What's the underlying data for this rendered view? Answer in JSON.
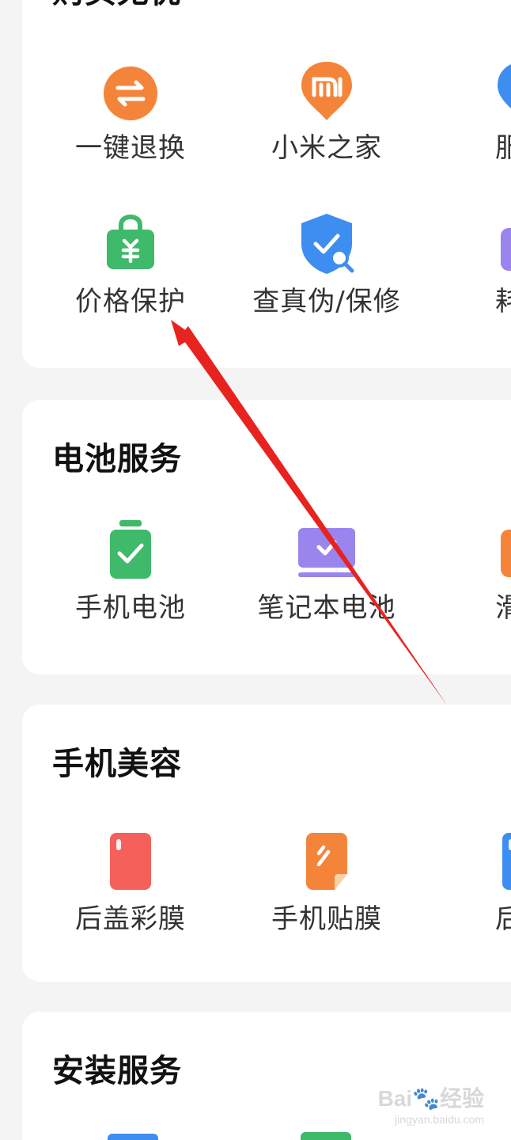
{
  "colors": {
    "orange": "#f5843b",
    "green": "#3fb96a",
    "blue": "#3d8ef0",
    "purple": "#9a84ee",
    "red": "#f5605a",
    "arrow": "#e8231f"
  },
  "sections": [
    {
      "title": "购买无忧",
      "items": [
        {
          "label": "一键退换",
          "icon": "exchange-icon"
        },
        {
          "label": "小米之家",
          "icon": "mi-location-icon"
        },
        {
          "label": "服务",
          "icon": "location-pin-icon"
        },
        {
          "label": "价格保护",
          "icon": "price-protect-bag-icon"
        },
        {
          "label": "查真伪/保修",
          "icon": "shield-check-icon"
        },
        {
          "label": "耗材",
          "icon": "consumables-icon"
        }
      ]
    },
    {
      "title": "电池服务",
      "items": [
        {
          "label": "手机电池",
          "icon": "phone-battery-icon"
        },
        {
          "label": "笔记本电池",
          "icon": "laptop-battery-icon"
        },
        {
          "label": "滑板",
          "icon": "scooter-battery-icon"
        }
      ]
    },
    {
      "title": "手机美容",
      "items": [
        {
          "label": "后盖彩膜",
          "icon": "back-cover-film-icon"
        },
        {
          "label": "手机贴膜",
          "icon": "screen-film-icon"
        },
        {
          "label": "后盖",
          "icon": "back-cover-icon"
        }
      ]
    },
    {
      "title": "安装服务",
      "items": []
    }
  ],
  "watermark": {
    "brand": "Bai🐾经验",
    "sub": "jingyan.baidu.com"
  }
}
